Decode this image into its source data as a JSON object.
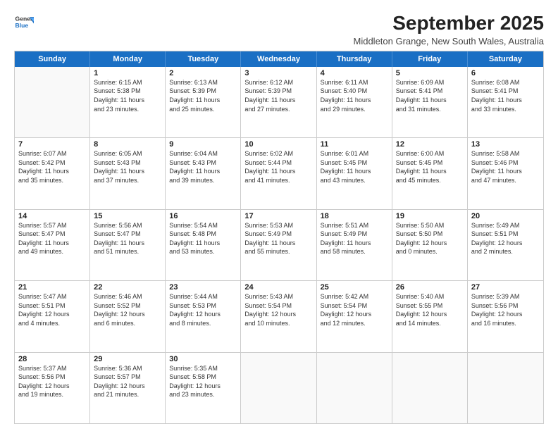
{
  "logo": {
    "line1": "General",
    "line2": "Blue"
  },
  "title": "September 2025",
  "subtitle": "Middleton Grange, New South Wales, Australia",
  "dayNames": [
    "Sunday",
    "Monday",
    "Tuesday",
    "Wednesday",
    "Thursday",
    "Friday",
    "Saturday"
  ],
  "weeks": [
    [
      {
        "day": "",
        "info": ""
      },
      {
        "day": "1",
        "info": "Sunrise: 6:15 AM\nSunset: 5:38 PM\nDaylight: 11 hours\nand 23 minutes."
      },
      {
        "day": "2",
        "info": "Sunrise: 6:13 AM\nSunset: 5:39 PM\nDaylight: 11 hours\nand 25 minutes."
      },
      {
        "day": "3",
        "info": "Sunrise: 6:12 AM\nSunset: 5:39 PM\nDaylight: 11 hours\nand 27 minutes."
      },
      {
        "day": "4",
        "info": "Sunrise: 6:11 AM\nSunset: 5:40 PM\nDaylight: 11 hours\nand 29 minutes."
      },
      {
        "day": "5",
        "info": "Sunrise: 6:09 AM\nSunset: 5:41 PM\nDaylight: 11 hours\nand 31 minutes."
      },
      {
        "day": "6",
        "info": "Sunrise: 6:08 AM\nSunset: 5:41 PM\nDaylight: 11 hours\nand 33 minutes."
      }
    ],
    [
      {
        "day": "7",
        "info": "Sunrise: 6:07 AM\nSunset: 5:42 PM\nDaylight: 11 hours\nand 35 minutes."
      },
      {
        "day": "8",
        "info": "Sunrise: 6:05 AM\nSunset: 5:43 PM\nDaylight: 11 hours\nand 37 minutes."
      },
      {
        "day": "9",
        "info": "Sunrise: 6:04 AM\nSunset: 5:43 PM\nDaylight: 11 hours\nand 39 minutes."
      },
      {
        "day": "10",
        "info": "Sunrise: 6:02 AM\nSunset: 5:44 PM\nDaylight: 11 hours\nand 41 minutes."
      },
      {
        "day": "11",
        "info": "Sunrise: 6:01 AM\nSunset: 5:45 PM\nDaylight: 11 hours\nand 43 minutes."
      },
      {
        "day": "12",
        "info": "Sunrise: 6:00 AM\nSunset: 5:45 PM\nDaylight: 11 hours\nand 45 minutes."
      },
      {
        "day": "13",
        "info": "Sunrise: 5:58 AM\nSunset: 5:46 PM\nDaylight: 11 hours\nand 47 minutes."
      }
    ],
    [
      {
        "day": "14",
        "info": "Sunrise: 5:57 AM\nSunset: 5:47 PM\nDaylight: 11 hours\nand 49 minutes."
      },
      {
        "day": "15",
        "info": "Sunrise: 5:56 AM\nSunset: 5:47 PM\nDaylight: 11 hours\nand 51 minutes."
      },
      {
        "day": "16",
        "info": "Sunrise: 5:54 AM\nSunset: 5:48 PM\nDaylight: 11 hours\nand 53 minutes."
      },
      {
        "day": "17",
        "info": "Sunrise: 5:53 AM\nSunset: 5:49 PM\nDaylight: 11 hours\nand 55 minutes."
      },
      {
        "day": "18",
        "info": "Sunrise: 5:51 AM\nSunset: 5:49 PM\nDaylight: 11 hours\nand 58 minutes."
      },
      {
        "day": "19",
        "info": "Sunrise: 5:50 AM\nSunset: 5:50 PM\nDaylight: 12 hours\nand 0 minutes."
      },
      {
        "day": "20",
        "info": "Sunrise: 5:49 AM\nSunset: 5:51 PM\nDaylight: 12 hours\nand 2 minutes."
      }
    ],
    [
      {
        "day": "21",
        "info": "Sunrise: 5:47 AM\nSunset: 5:51 PM\nDaylight: 12 hours\nand 4 minutes."
      },
      {
        "day": "22",
        "info": "Sunrise: 5:46 AM\nSunset: 5:52 PM\nDaylight: 12 hours\nand 6 minutes."
      },
      {
        "day": "23",
        "info": "Sunrise: 5:44 AM\nSunset: 5:53 PM\nDaylight: 12 hours\nand 8 minutes."
      },
      {
        "day": "24",
        "info": "Sunrise: 5:43 AM\nSunset: 5:54 PM\nDaylight: 12 hours\nand 10 minutes."
      },
      {
        "day": "25",
        "info": "Sunrise: 5:42 AM\nSunset: 5:54 PM\nDaylight: 12 hours\nand 12 minutes."
      },
      {
        "day": "26",
        "info": "Sunrise: 5:40 AM\nSunset: 5:55 PM\nDaylight: 12 hours\nand 14 minutes."
      },
      {
        "day": "27",
        "info": "Sunrise: 5:39 AM\nSunset: 5:56 PM\nDaylight: 12 hours\nand 16 minutes."
      }
    ],
    [
      {
        "day": "28",
        "info": "Sunrise: 5:37 AM\nSunset: 5:56 PM\nDaylight: 12 hours\nand 19 minutes."
      },
      {
        "day": "29",
        "info": "Sunrise: 5:36 AM\nSunset: 5:57 PM\nDaylight: 12 hours\nand 21 minutes."
      },
      {
        "day": "30",
        "info": "Sunrise: 5:35 AM\nSunset: 5:58 PM\nDaylight: 12 hours\nand 23 minutes."
      },
      {
        "day": "",
        "info": ""
      },
      {
        "day": "",
        "info": ""
      },
      {
        "day": "",
        "info": ""
      },
      {
        "day": "",
        "info": ""
      }
    ]
  ]
}
